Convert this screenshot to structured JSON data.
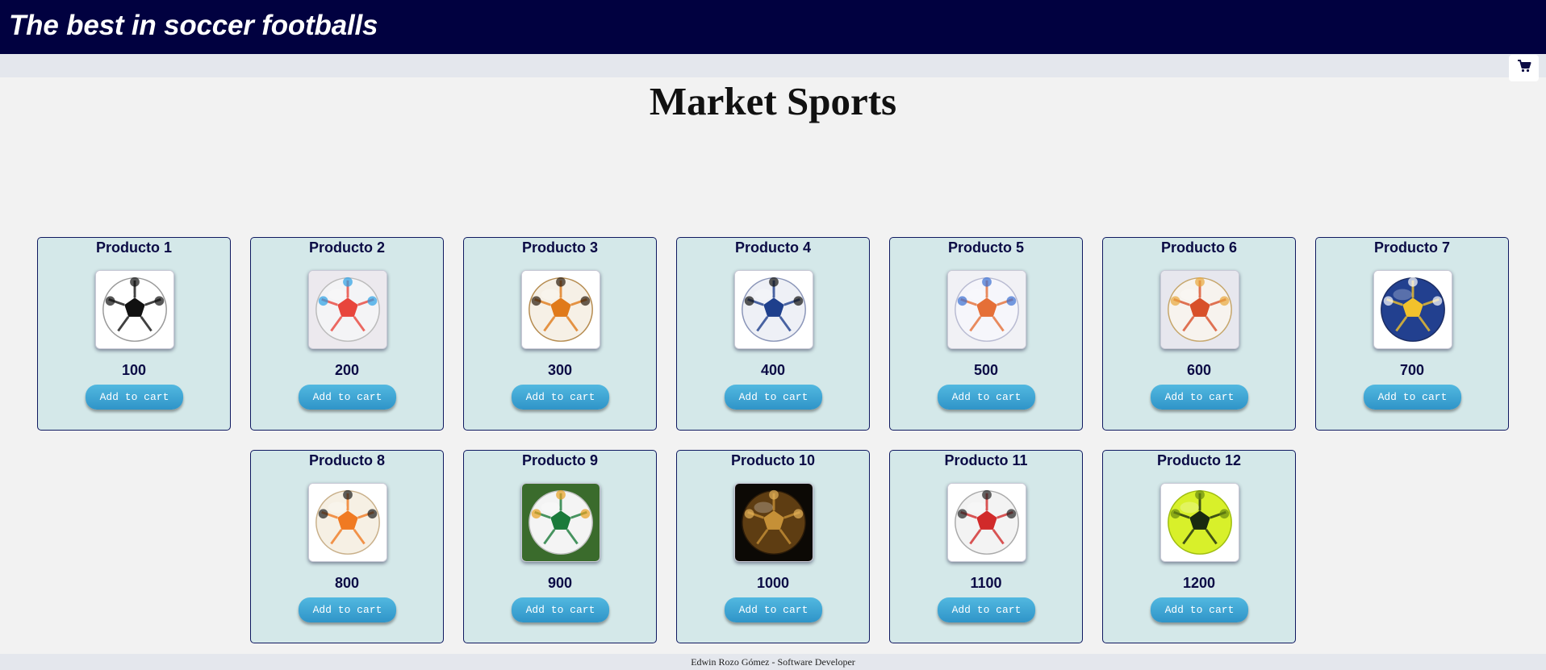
{
  "header": {
    "title": "The best in soccer footballs"
  },
  "cart": {
    "icon": "shopping-cart-icon"
  },
  "page": {
    "title": "Market Sports"
  },
  "products": [
    {
      "name": "Producto 1",
      "price": "100",
      "button": "Add to cart",
      "style": "classic"
    },
    {
      "name": "Producto 2",
      "price": "200",
      "button": "Add to cart",
      "style": "adidas-x"
    },
    {
      "name": "Producto 3",
      "price": "300",
      "button": "Add to cart",
      "style": "molten-orange"
    },
    {
      "name": "Producto 4",
      "price": "400",
      "button": "Add to cart",
      "style": "molten-blue"
    },
    {
      "name": "Producto 5",
      "price": "500",
      "button": "Add to cart",
      "style": "star-orange"
    },
    {
      "name": "Producto 6",
      "price": "600",
      "button": "Add to cart",
      "style": "star-red"
    },
    {
      "name": "Producto 7",
      "price": "700",
      "button": "Add to cart",
      "style": "molten-navy"
    },
    {
      "name": "Producto 8",
      "price": "800",
      "button": "Add to cart",
      "style": "nike"
    },
    {
      "name": "Producto 9",
      "price": "900",
      "button": "Add to cart",
      "style": "brazuca"
    },
    {
      "name": "Producto 10",
      "price": "1000",
      "button": "Add to cart",
      "style": "golden-dark"
    },
    {
      "name": "Producto 11",
      "price": "1100",
      "button": "Add to cart",
      "style": "golty"
    },
    {
      "name": "Producto 12",
      "price": "1200",
      "button": "Add to cart",
      "style": "neon"
    }
  ],
  "footer": {
    "text": "Edwin Rozo Gómez - Software Developer"
  },
  "colors": {
    "header_bg": "#010140",
    "card_bg": "#d4e8e9",
    "button": "#3aa3d4",
    "text": "#0b0b45"
  }
}
